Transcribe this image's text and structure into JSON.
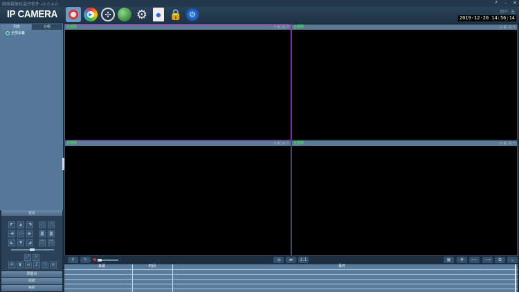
{
  "app": {
    "title": "网络摄像机监控软件 v2.0.4.0",
    "logo": "IP CAMERA",
    "user": "用户: 无",
    "datetime": "2019-12-20  14:56:14"
  },
  "window_controls": {
    "help": "?",
    "minimize": "–",
    "close": "×"
  },
  "toolbar_icons": [
    "live-view-icon",
    "playback-icon",
    "film-reel-icon",
    "globe-icon",
    "gear-icon",
    "record-document-icon",
    "lock-icon",
    "power-icon"
  ],
  "left": {
    "tabs": [
      "列表",
      "分组"
    ],
    "tree_root": "全部设备",
    "ptz_title": "云台",
    "buttons": [
      "预置点",
      "巡航",
      "色彩"
    ]
  },
  "video": {
    "cells": [
      {
        "status": "无视频"
      },
      {
        "status": "无视频"
      },
      {
        "status": "无视频"
      },
      {
        "status": "无视频"
      }
    ]
  },
  "log": {
    "columns": [
      "来源",
      "时间",
      "事件"
    ]
  },
  "colors": {
    "no_video": "#3cff3c",
    "selected_border": "#a040c0"
  }
}
